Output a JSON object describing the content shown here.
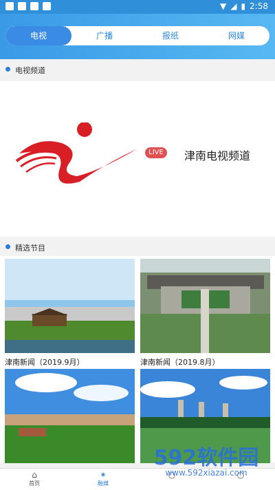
{
  "status": {
    "time": "2:58"
  },
  "tabs": [
    {
      "label": "电视",
      "active": true
    },
    {
      "label": "广播",
      "active": false
    },
    {
      "label": "报纸",
      "active": false
    },
    {
      "label": "网媒",
      "active": false
    }
  ],
  "channel_section": {
    "title": "电视频道"
  },
  "channel": {
    "badge": "LIVE",
    "name": "津南电视频道"
  },
  "featured_section": {
    "title": "精选节目"
  },
  "programs": [
    {
      "caption": "津南新闻（2019.9月）"
    },
    {
      "caption": "津南新闻（2019.8月）"
    },
    {
      "caption": ""
    },
    {
      "caption": ""
    }
  ],
  "bottom_nav": [
    {
      "label": "首页",
      "icon": "home-icon",
      "active": false
    },
    {
      "label": "融媒",
      "icon": "media-icon",
      "active": true
    },
    {
      "label": "",
      "icon": "hidden-icon",
      "active": false
    },
    {
      "label": "",
      "icon": "hidden-icon",
      "active": false
    }
  ],
  "watermark": {
    "brand": "592软件园",
    "url": "www.592xiazai.com"
  }
}
